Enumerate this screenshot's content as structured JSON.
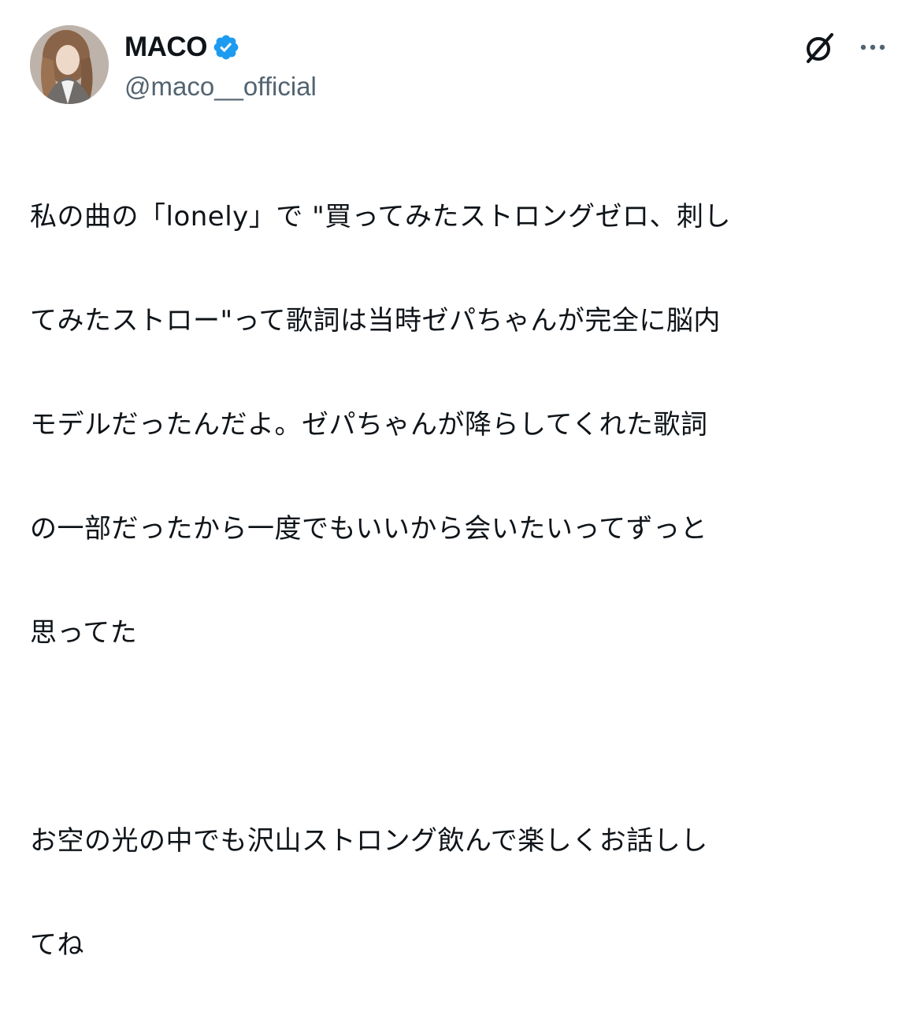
{
  "author": {
    "display_name": "MACO",
    "handle": "@maco__official",
    "verified": true,
    "avatar_icon": "avatar-photo"
  },
  "actions": {
    "grok_icon": "grok-icon",
    "more_icon": "more-icon"
  },
  "tweet": {
    "paragraph_1_lines": [
      "私の曲の「lonely」で \"買ってみたストロングゼロ、刺し",
      "てみたストロー\"って歌詞は当時ゼパちゃんが完全に脳内",
      "モデルだったんだよ。ゼパちゃんが降らしてくれた歌詞",
      "の一部だったから一度でもいいから会いたいってずっと",
      "思ってた"
    ],
    "paragraph_2_lines": [
      "お空の光の中でも沢山ストロング飲んで楽しくお話しし",
      "てね"
    ]
  },
  "colors": {
    "text": "#0f1419",
    "secondary": "#536471",
    "verified": "#1d9bf0"
  }
}
